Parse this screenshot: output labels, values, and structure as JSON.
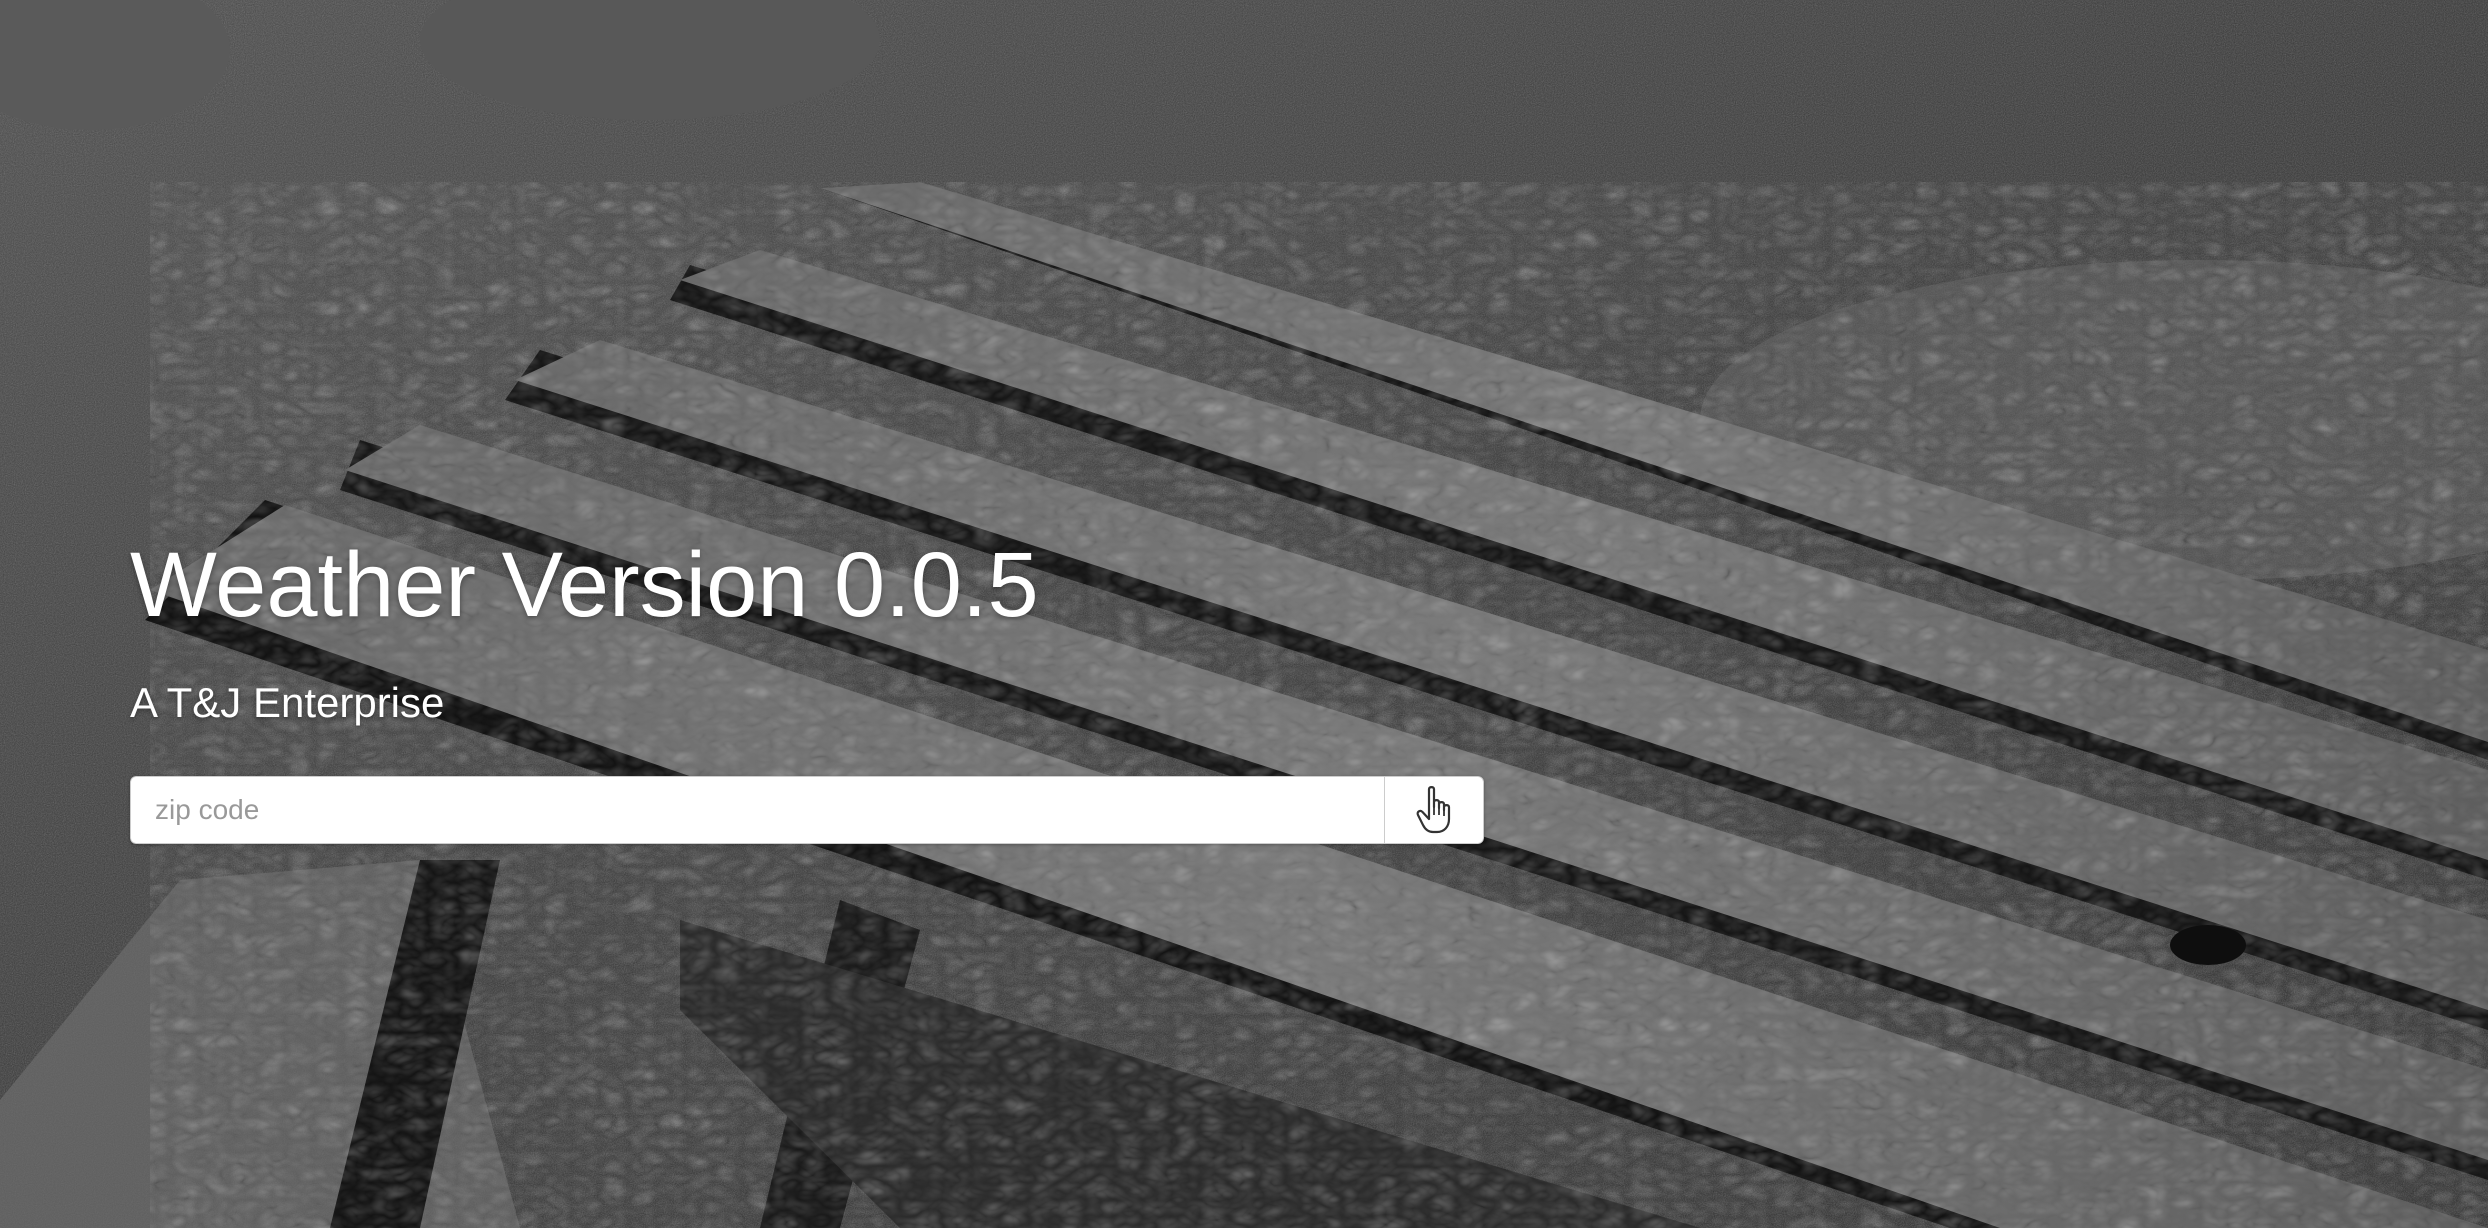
{
  "hero": {
    "title": "Weather Version 0.0.5",
    "subtitle": "A T&J Enterprise"
  },
  "search": {
    "placeholder": "zip code",
    "value": "",
    "submit_icon": "pointing-hand-icon"
  },
  "colors": {
    "text": "#ffffff",
    "input_bg": "#ffffff",
    "input_border": "#cccccc",
    "placeholder": "#999999"
  },
  "background": {
    "description_icon": "wet-bench-photo"
  }
}
